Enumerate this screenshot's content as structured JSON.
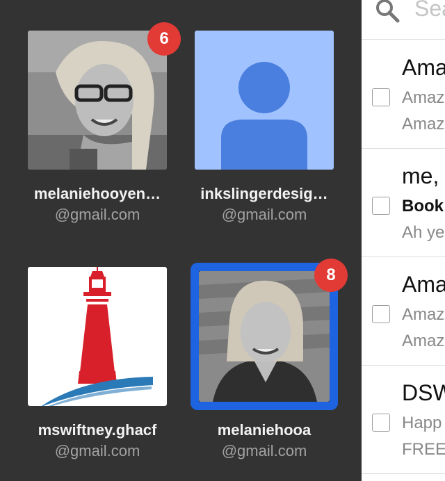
{
  "accounts": [
    {
      "name": "melaniehooyen…",
      "email": "@gmail.com",
      "badge": "6"
    },
    {
      "name": "inkslingerdesig…",
      "email": "@gmail.com",
      "badge": ""
    },
    {
      "name": "mswiftney.ghacf",
      "email": "@gmail.com",
      "badge": ""
    },
    {
      "name": "melaniehooa",
      "email": "@gmail.com",
      "badge": "8"
    }
  ],
  "search": {
    "placeholder": "Sea"
  },
  "emails": [
    {
      "sender": "Ama",
      "subject": "Amaz",
      "preview": "Amaz"
    },
    {
      "sender": "me,",
      "subject": "Book",
      "preview": "Ah ye"
    },
    {
      "sender": "Ama",
      "subject": "Amaz",
      "preview": "Amaz"
    },
    {
      "sender": "DSW",
      "subject": "Happ",
      "preview": "FREE"
    }
  ],
  "colors": {
    "selected_border": "#1e63df",
    "badge": "#e23a35",
    "default_avatar_bg": "#a0c3ff",
    "default_avatar_fg": "#4a7fe0"
  },
  "icons": {
    "search": "search-icon",
    "default_avatar": "person-icon",
    "lighthouse": "lighthouse-icon"
  }
}
